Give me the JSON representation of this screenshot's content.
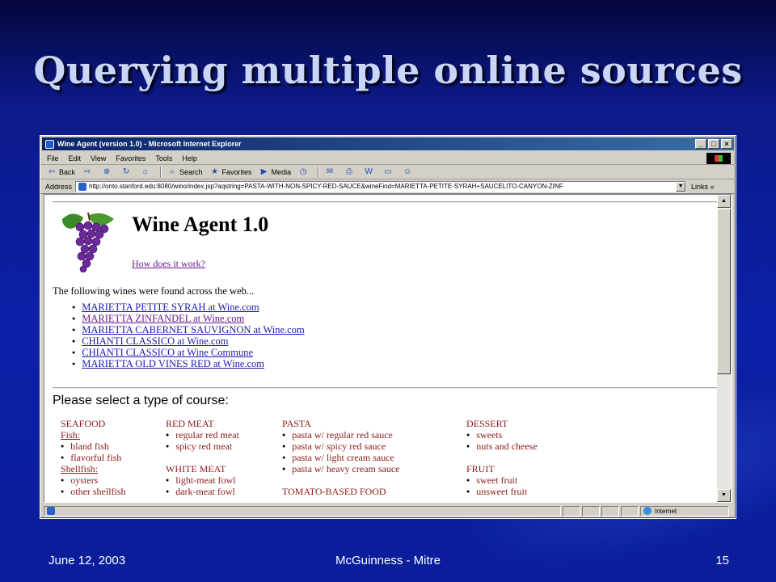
{
  "slide": {
    "title": "Querying multiple online sources",
    "footer_date": "June 12, 2003",
    "footer_center": "McGuinness - Mitre",
    "footer_page": "15"
  },
  "window": {
    "title": "Wine Agent (version 1.0) - Microsoft Internet Explorer",
    "minimize": "_",
    "maximize": "□",
    "close": "×"
  },
  "menu": [
    "File",
    "Edit",
    "View",
    "Favorites",
    "Tools",
    "Help"
  ],
  "toolbar": {
    "back": "Back",
    "search": "Search",
    "favorites": "Favorites",
    "media": "Media"
  },
  "address": {
    "label": "Address",
    "url": "http://onto.stanford.edu:8080/wino/index.jsp?aqstring=PASTA-WITH-NON-SPICY-RED-SAUCE&wineFind=MARIETTA-PETITE-SYRAH+SAUCELITO-CANYON-ZINF",
    "links": "Links »"
  },
  "page": {
    "heading": "Wine Agent 1.0",
    "how_link": "How does it work?",
    "found_text": "The following wines were found across the web...",
    "wines": [
      "MARIETTA PETITE SYRAH at Wine.com",
      "MARIETTA ZINFANDEL at Wine.com",
      "MARIETTA CABERNET SAUVIGNON at Wine.com",
      "CHIANTI CLASSICO at Wine.com",
      "CHIANTI CLASSICO at Wine Commune",
      "MARIETTA OLD VINES RED at Wine.com"
    ],
    "course_prompt": "Please select a type of course:",
    "courses": {
      "seafood": "SEAFOOD",
      "fish": "Fish:",
      "bland_fish": "bland fish",
      "flavorful_fish": "flavorful fish",
      "shellfish": "Shellfish:",
      "oysters": "oysters",
      "other_shellfish": "other shellfish",
      "red_meat": "RED MEAT",
      "regular_red_meat": "regular red meat",
      "spicy_red_meat": "spicy red meat",
      "white_meat": "WHITE MEAT",
      "light_meat_fowl": "light-meat fowl",
      "dark_meat_fowl": "dark-meat fowl",
      "pasta": "PASTA",
      "pasta_regular_red": "pasta w/ regular red sauce",
      "pasta_spicy_red": "pasta w/ spicy red sauce",
      "pasta_light_cream": "pasta w/ light cream sauce",
      "pasta_heavy_cream": "pasta w/ heavy cream sauce",
      "tomato_based": "TOMATO-BASED FOOD",
      "dessert": "DESSERT",
      "sweets": "sweets",
      "nuts_cheese": "nuts and cheese",
      "fruit": "FRUIT",
      "sweet_fruit": "sweet fruit",
      "unsweet_fruit": "unsweet fruit"
    }
  },
  "status": {
    "zone": "Internet"
  }
}
